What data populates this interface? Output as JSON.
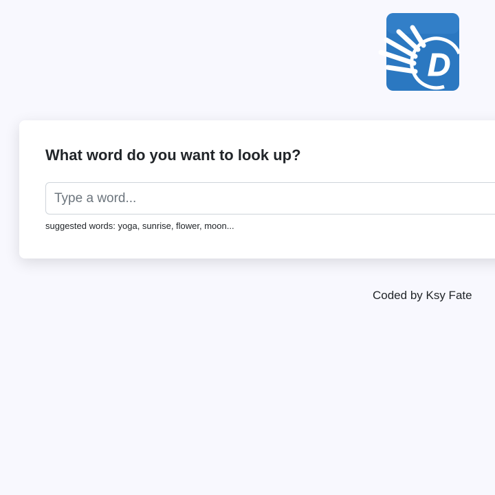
{
  "logo": {
    "icon": "dictionary-d-sunburst-icon",
    "letter": "D",
    "background_color": "#2b78c1",
    "accent_color": "#ffffff"
  },
  "search_card": {
    "title": "What word do you want to look up?",
    "input": {
      "placeholder": "Type a word...",
      "value": ""
    },
    "hint": "suggested words: yoga, sunrise, flower, moon..."
  },
  "footer": {
    "credit": "Coded by Ksy Fate"
  },
  "colors": {
    "page_background": "#f8f8fe",
    "card_background": "#ffffff",
    "text": "#212529"
  }
}
